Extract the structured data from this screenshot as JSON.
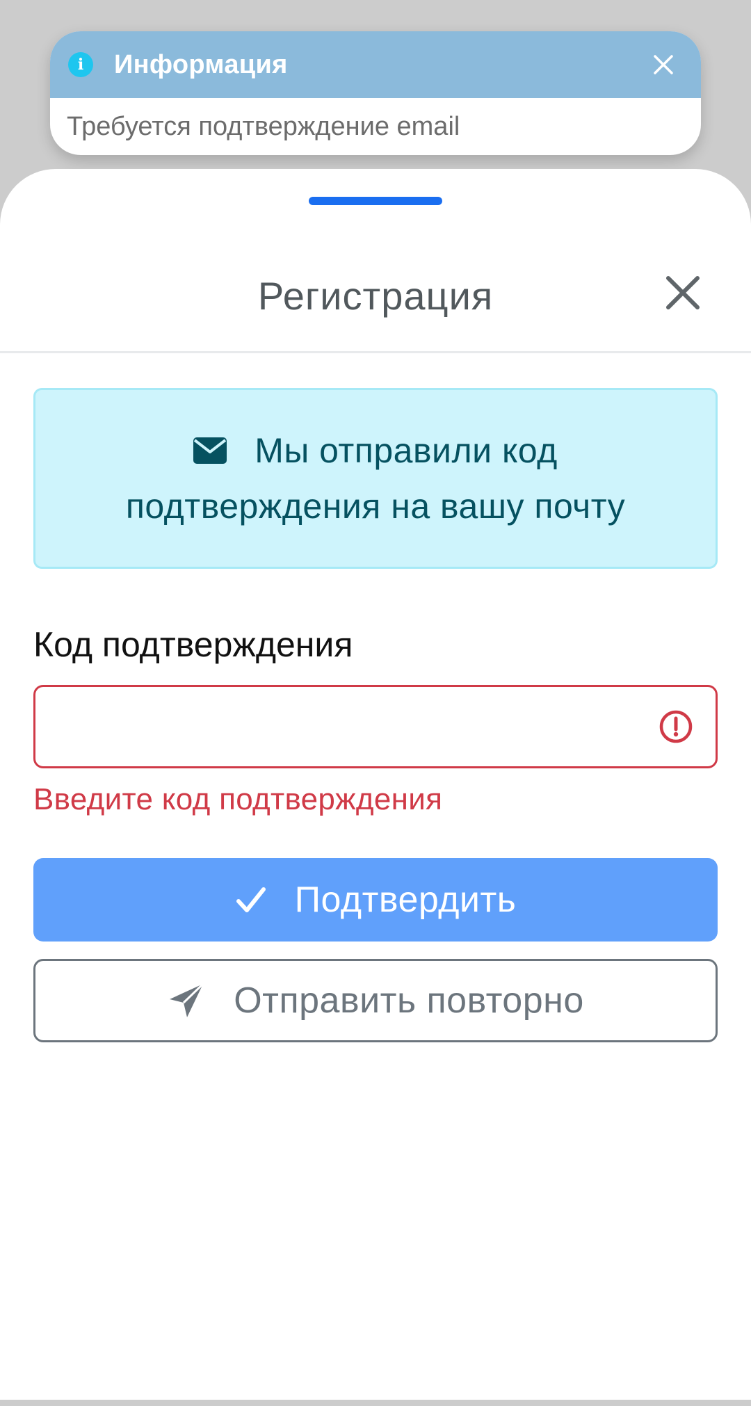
{
  "toast": {
    "title": "Информация",
    "message": "Требуется подтверждение email",
    "icon": "info-icon",
    "close_icon": "close-icon"
  },
  "sheet": {
    "title": "Регистрация",
    "close_icon": "close-icon"
  },
  "alert": {
    "icon": "envelope-icon",
    "line1": "Мы отправили код",
    "line2": "подтверждения на вашу почту"
  },
  "form": {
    "code_label": "Код подтверждения",
    "code_value": "",
    "error_icon": "exclamation-circle-icon",
    "error_message": "Введите код подтверждения"
  },
  "buttons": {
    "confirm_label": "Подтвердить",
    "confirm_icon": "check-icon",
    "resend_label": "Отправить повторно",
    "resend_icon": "send-icon"
  },
  "colors": {
    "toast_header": "#8bbadb",
    "accent": "#1a6ef0",
    "alert_bg": "#cef4fc",
    "alert_text": "#055160",
    "error": "#d03a47",
    "primary_button": "#60a0fb",
    "secondary": "#6c757d"
  }
}
